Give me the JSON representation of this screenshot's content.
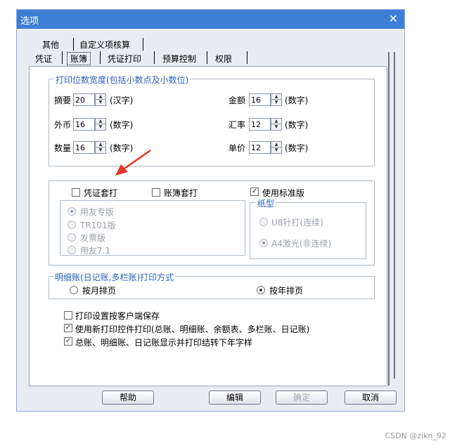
{
  "window": {
    "title": "选项",
    "close_symbol": "✕"
  },
  "tabs_row1": [
    "其他",
    "自定义项核算"
  ],
  "tabs_row2": [
    "凭证",
    "账簿",
    "凭证打印",
    "预算控制",
    "权限"
  ],
  "digits": {
    "legend": "打印位数宽度(包括小数点及小数位)",
    "fields": [
      {
        "label": "摘要",
        "value": "20",
        "unit": "(汉字)"
      },
      {
        "label": "外币",
        "value": "16",
        "unit": "(数字)"
      },
      {
        "label": "数量",
        "value": "16",
        "unit": "(数字)"
      },
      {
        "label": "金额",
        "value": "16",
        "unit": "(数字)"
      },
      {
        "label": "汇率",
        "value": "12",
        "unit": "(数字)"
      },
      {
        "label": "单价",
        "value": "12",
        "unit": "(数字)"
      }
    ]
  },
  "overprint": {
    "voucher_overprint": {
      "label": "凭证套打",
      "checked": false
    },
    "ledger_overprint": {
      "label": "账簿套打",
      "checked": false
    },
    "use_standard": {
      "label": "使用标准版",
      "checked": true
    },
    "versions": [
      {
        "label": "用友专版",
        "selected": true
      },
      {
        "label": "TR101版",
        "selected": false
      },
      {
        "label": "发票版",
        "selected": false
      },
      {
        "label": "用友7.1",
        "selected": false
      }
    ],
    "paper": {
      "legend": "纸型",
      "options": [
        {
          "label": "U8针打(连续)",
          "selected": false
        },
        {
          "label": "A4激光(非连续)",
          "selected": true
        }
      ]
    }
  },
  "detail_print": {
    "legend": "明细账(日记账,多栏账)打印方式",
    "options": [
      {
        "label": "按月排页",
        "selected": false
      },
      {
        "label": "按年排页",
        "selected": true
      }
    ]
  },
  "options": [
    {
      "label": "打印设置按客户端保存",
      "checked": false
    },
    {
      "label": "使用新打印控件打印(总账、明细账、余额表、多栏账、日记账)",
      "checked": true
    },
    {
      "label": "总账、明细账、日记账显示并打印结转下年字样",
      "checked": true
    }
  ],
  "buttons": {
    "help": "帮助",
    "edit": "编辑",
    "confirm": "确定",
    "cancel": "取消"
  },
  "watermark": "CSDN @zikn_92",
  "colors": {
    "titlebar": "#3e7fd6",
    "legend_text": "#2a62b8",
    "arrow": "#e8332a"
  }
}
